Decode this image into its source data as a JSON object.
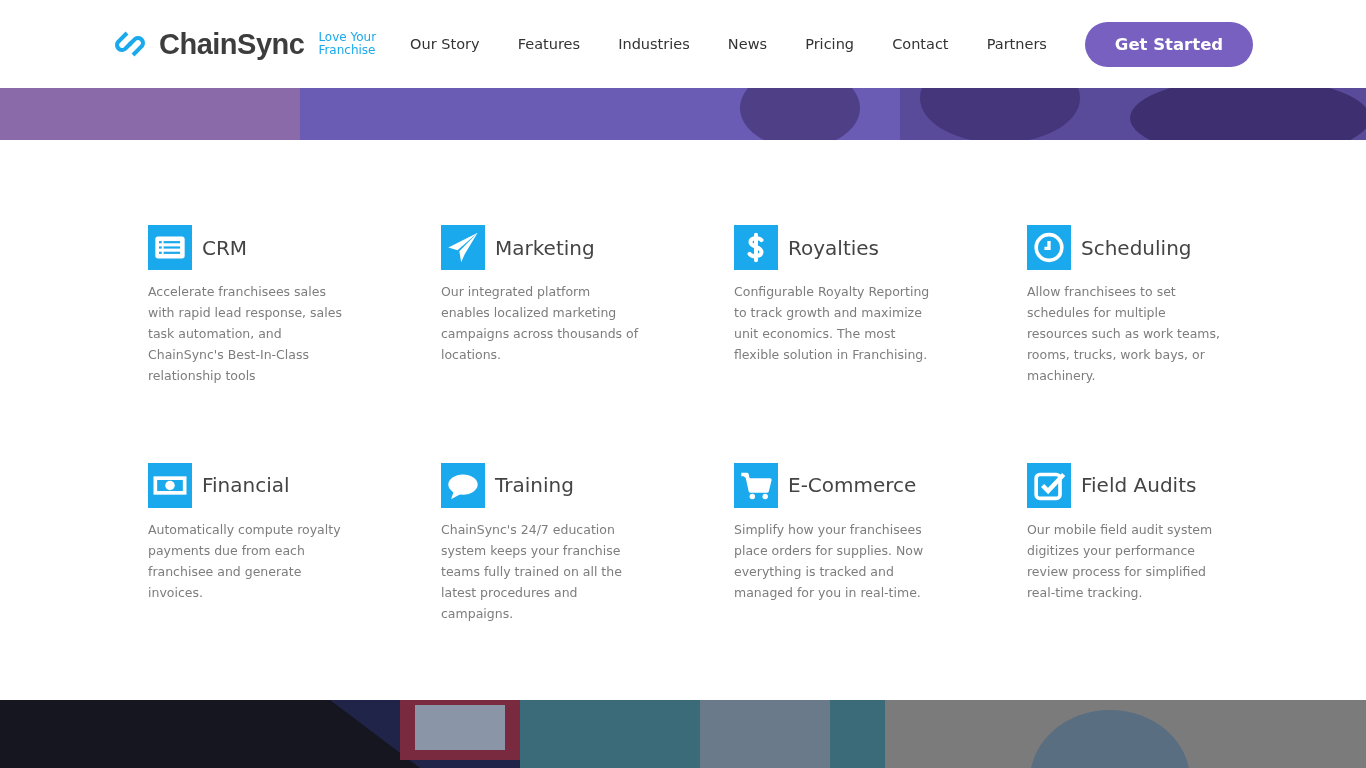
{
  "header": {
    "logo": {
      "name": "ChainSync",
      "tagline_1": "Love Your",
      "tagline_2": "Franchise"
    },
    "nav": [
      "Our Story",
      "Features",
      "Industries",
      "News",
      "Pricing",
      "Contact",
      "Partners"
    ],
    "cta": "Get Started"
  },
  "features": [
    {
      "title": "CRM",
      "text": "Accelerate franchisees sales with rapid lead response, sales task automation, and ChainSync's Best-In-Class relationship tools"
    },
    {
      "title": "Marketing",
      "text": "Our integrated platform enables localized marketing campaigns across thousands of locations."
    },
    {
      "title": "Royalties",
      "text": "Configurable Royalty Reporting to track growth and maximize unit economics. The most flexible solution in Franchising."
    },
    {
      "title": "Scheduling",
      "text": "Allow franchisees to set schedules for multiple resources such as work teams, rooms, trucks, work bays, or machinery."
    },
    {
      "title": "Financial",
      "text": "Automatically compute royalty payments due from each franchisee and generate invoices."
    },
    {
      "title": "Training",
      "text": "ChainSync's 24/7 education system keeps your franchise teams fully trained on all the latest procedures and campaigns."
    },
    {
      "title": "E-Commerce",
      "text": "Simplify how your franchisees place orders for supplies. Now everything is tracked and managed for you in real-time."
    },
    {
      "title": "Field Audits",
      "text": "Our mobile field audit system digitizes your performance review process for simplified real-time tracking."
    }
  ]
}
